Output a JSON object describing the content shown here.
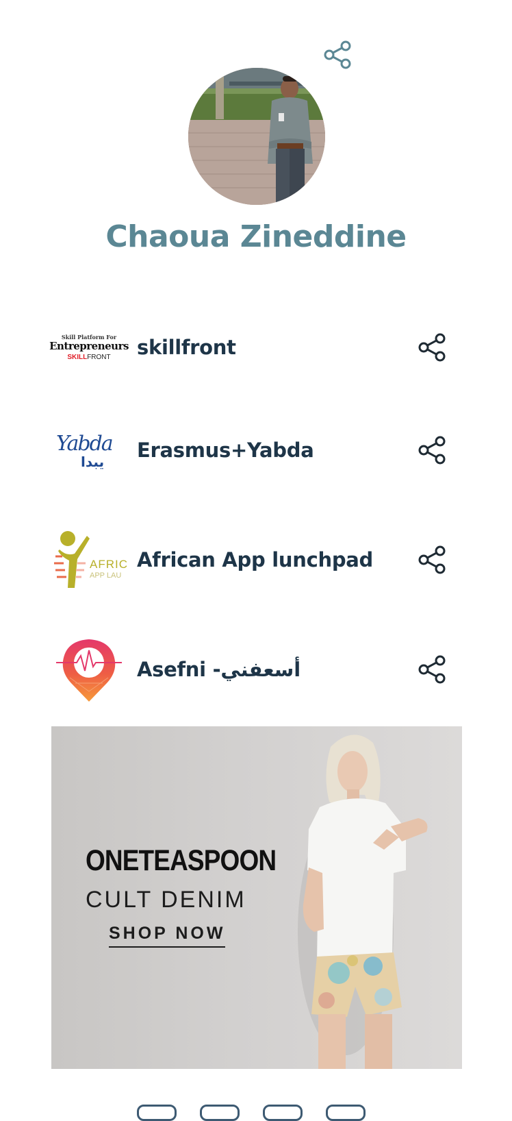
{
  "profile": {
    "name": "Chaoua Zineddine",
    "share_icon": "share-icon"
  },
  "links": [
    {
      "label": "skillfront",
      "logo": {
        "line1": "Skill Platform For",
        "line2": "Entrepreneurs",
        "line3_red": "SKILL",
        "line3_dark": "FRONT"
      },
      "icon": "share-icon"
    },
    {
      "label": "Erasmus+Yabda",
      "logo": {
        "latin": "Yabda",
        "arabic": "يبدا"
      },
      "icon": "share-icon"
    },
    {
      "label": "African App lunchpad",
      "logo": {
        "line1": "AFRIC",
        "line2": "APP LAU"
      },
      "icon": "share-icon"
    },
    {
      "label": "Asefni -أسعفني",
      "logo": {},
      "icon": "share-icon"
    }
  ],
  "ad": {
    "brand": "ONETEASPOON",
    "subtitle": "CULT DENIM",
    "cta": "SHOP NOW"
  },
  "colors": {
    "name": "#5b8794",
    "label": "#1e3548",
    "share_top": "#5b8794",
    "share_row": "#1e2a33"
  }
}
